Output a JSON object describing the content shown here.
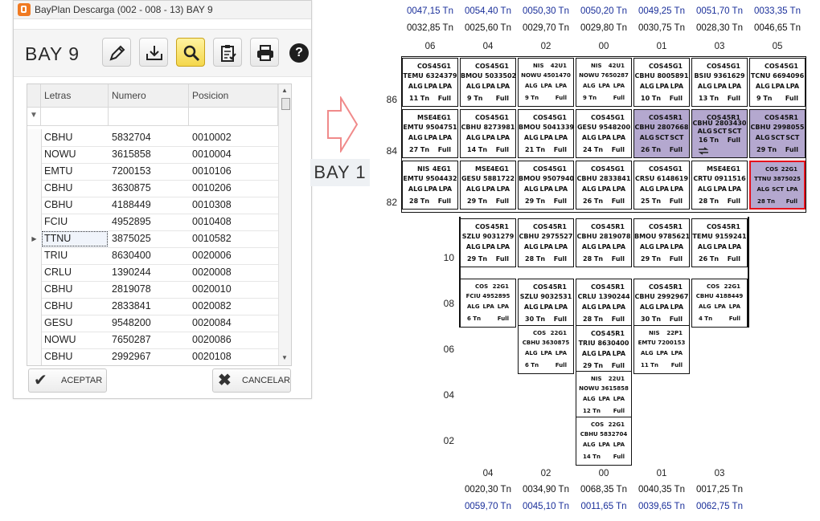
{
  "window": {
    "title": "BayPlan Descarga (002 - 008 - 13) BAY 9",
    "bay_label": "BAY 9",
    "toolbar_icons": [
      "pencil-icon",
      "download-tray-icon",
      "magnifier-icon",
      "clipboard-check-icon",
      "printer-icon",
      "help-icon"
    ],
    "help_label": "?"
  },
  "grid": {
    "columns": [
      "Letras",
      "Numero",
      "Posicion"
    ],
    "rows": [
      {
        "letras": "CBHU",
        "numero": "5832704",
        "posicion": "0010002"
      },
      {
        "letras": "NOWU",
        "numero": "3615858",
        "posicion": "0010004"
      },
      {
        "letras": "EMTU",
        "numero": "7200153",
        "posicion": "0010106"
      },
      {
        "letras": "CBHU",
        "numero": "3630875",
        "posicion": "0010206"
      },
      {
        "letras": "CBHU",
        "numero": "4188449",
        "posicion": "0010308"
      },
      {
        "letras": "FCIU",
        "numero": "4952895",
        "posicion": "0010408"
      },
      {
        "letras": "TTNU",
        "numero": "3875025",
        "posicion": "0010582"
      },
      {
        "letras": "TRIU",
        "numero": "8630400",
        "posicion": "0020006"
      },
      {
        "letras": "CRLU",
        "numero": "1390244",
        "posicion": "0020008"
      },
      {
        "letras": "CBHU",
        "numero": "2819078",
        "posicion": "0020010"
      },
      {
        "letras": "CBHU",
        "numero": "2833841",
        "posicion": "0020082"
      },
      {
        "letras": "GESU",
        "numero": "9548200",
        "posicion": "0020084"
      },
      {
        "letras": "NOWU",
        "numero": "7650287",
        "posicion": "0020086"
      },
      {
        "letras": "CBHU",
        "numero": "2992967",
        "posicion": "0020108"
      }
    ],
    "selected_index": 6
  },
  "footer": {
    "accept_label": "ACEPTAR",
    "cancel_label": "CANCELAR"
  },
  "bay1_label": "BAY 1",
  "top": {
    "columns": [
      "06",
      "04",
      "02",
      "00",
      "01",
      "03",
      "05"
    ],
    "blue_weights": [
      "0047,15 Tn",
      "0054,40 Tn",
      "0050,30 Tn",
      "0050,20 Tn",
      "0049,25 Tn",
      "0051,70 Tn",
      "0033,35 Tn"
    ],
    "black_weights": [
      "0032,85 Tn",
      "0025,60 Tn",
      "0029,70 Tn",
      "0029,80 Tn",
      "0030,75 Tn",
      "0028,30 Tn",
      "0046,65 Tn"
    ],
    "tiers": [
      "86",
      "84",
      "82"
    ],
    "slots": [
      [
        {
          "op": "COS",
          "iso": "45G1",
          "ctr": "TEMU 6324379",
          "ports": [
            "ALG",
            "LPA",
            "LPA"
          ],
          "wt": "11 Tn",
          "st": "Full",
          "shade": false
        },
        {
          "op": "COS",
          "iso": "45G1",
          "ctr": "BMOU 5033502",
          "ports": [
            "ALG",
            "LPA",
            "LPA"
          ],
          "wt": "9 Tn",
          "st": "Full",
          "shade": false
        },
        {
          "op": "NIS",
          "iso": "42U1",
          "ctr": "NOWU 4501470",
          "ports": [
            "ALG",
            "LPA",
            "LPA"
          ],
          "wt": "9 Tn",
          "st": "Full",
          "shade": false,
          "small": true
        },
        {
          "op": "NIS",
          "iso": "42U1",
          "ctr": "NOWU 7650287",
          "ports": [
            "ALG",
            "LPA",
            "LPA"
          ],
          "wt": "9 Tn",
          "st": "Full",
          "shade": false,
          "small": true
        },
        {
          "op": "COS",
          "iso": "45G1",
          "ctr": "CBHU 8005891",
          "ports": [
            "ALG",
            "LPA",
            "LPA"
          ],
          "wt": "10 Tn",
          "st": "Full",
          "shade": false
        },
        {
          "op": "COS",
          "iso": "45G1",
          "ctr": "BSIU 9361629",
          "ports": [
            "ALG",
            "LPA",
            "LPA"
          ],
          "wt": "13 Tn",
          "st": "Full",
          "shade": false
        },
        {
          "op": "COS",
          "iso": "45G1",
          "ctr": "TCNU 6694096",
          "ports": [
            "ALG",
            "LPA",
            "LPA"
          ],
          "wt": "9 Tn",
          "st": "Full",
          "shade": false
        }
      ],
      [
        {
          "op": "MSE",
          "iso": "4EG1",
          "ctr": "EMTU 9504751",
          "ports": [
            "ALG",
            "LPA",
            "LPA"
          ],
          "wt": "27 Tn",
          "st": "Full",
          "shade": false
        },
        {
          "op": "COS",
          "iso": "45G1",
          "ctr": "CBHU 8273981",
          "ports": [
            "ALG",
            "LPA",
            "LPA"
          ],
          "wt": "14 Tn",
          "st": "Full",
          "shade": false
        },
        {
          "op": "COS",
          "iso": "45G1",
          "ctr": "BMOU 5041339",
          "ports": [
            "ALG",
            "LPA",
            "LPA"
          ],
          "wt": "21 Tn",
          "st": "Full",
          "shade": false
        },
        {
          "op": "COS",
          "iso": "45G1",
          "ctr": "GESU 9548200",
          "ports": [
            "ALG",
            "LPA",
            "LPA"
          ],
          "wt": "24 Tn",
          "st": "Full",
          "shade": false
        },
        {
          "op": "COS",
          "iso": "45R1",
          "ctr": "CBHU 2807668",
          "ports": [
            "ALG",
            "SCT",
            "SCT"
          ],
          "wt": "26 Tn",
          "st": "Full",
          "shade": true
        },
        {
          "op": "COS",
          "iso": "45R1",
          "ctr": "CBHU 2803430",
          "ports": [
            "ALG",
            "SCT",
            "SCT"
          ],
          "wt": "16 Tn",
          "st": "Full",
          "shade": true,
          "swap": true
        },
        {
          "op": "COS",
          "iso": "45R1",
          "ctr": "CBHU 2998055",
          "ports": [
            "ALG",
            "SCT",
            "SCT"
          ],
          "wt": "29 Tn",
          "st": "Full",
          "shade": true
        }
      ],
      [
        {
          "op": "NIS",
          "iso": "4EG1",
          "ctr": "EMTU 9504432",
          "ports": [
            "ALG",
            "LPA",
            "LPA"
          ],
          "wt": "28 Tn",
          "st": "Full",
          "shade": false
        },
        {
          "op": "MSE",
          "iso": "4EG1",
          "ctr": "GESU 5881722",
          "ports": [
            "ALG",
            "LPA",
            "LPA"
          ],
          "wt": "29 Tn",
          "st": "Full",
          "shade": false
        },
        {
          "op": "COS",
          "iso": "45G1",
          "ctr": "BMOU 9507940",
          "ports": [
            "ALG",
            "LPA",
            "LPA"
          ],
          "wt": "29 Tn",
          "st": "Full",
          "shade": false
        },
        {
          "op": "COS",
          "iso": "45G1",
          "ctr": "CBHU 2833841",
          "ports": [
            "ALG",
            "LPA",
            "LPA"
          ],
          "wt": "26 Tn",
          "st": "Full",
          "shade": false
        },
        {
          "op": "COS",
          "iso": "45G1",
          "ctr": "CRSU 6148619",
          "ports": [
            "ALG",
            "LPA",
            "LPA"
          ],
          "wt": "25 Tn",
          "st": "Full",
          "shade": false
        },
        {
          "op": "MSE",
          "iso": "4EG1",
          "ctr": "CRTU 0911516",
          "ports": [
            "ALG",
            "LPA",
            "LPA"
          ],
          "wt": "28 Tn",
          "st": "Full",
          "shade": false
        },
        {
          "op": "COS",
          "iso": "22G1",
          "ctr": "TTNU 3875025",
          "ports": [
            "ALG",
            "SCT",
            "LPA"
          ],
          "wt": "28 Tn",
          "st": "Full",
          "shade": true,
          "red": true,
          "small": true
        }
      ]
    ]
  },
  "bottom": {
    "columns": [
      "04",
      "02",
      "00",
      "01",
      "03"
    ],
    "black_weights": [
      "0020,30 Tn",
      "0034,90 Tn",
      "0068,35 Tn",
      "0040,35 Tn",
      "0017,25 Tn"
    ],
    "blue_weights": [
      "0059,70 Tn",
      "0045,10 Tn",
      "0011,65 Tn",
      "0039,65 Tn",
      "0062,75 Tn"
    ],
    "tiers": [
      "10",
      "08",
      "06",
      "04",
      "02"
    ],
    "slots": [
      [
        {
          "op": "COS",
          "iso": "45R1",
          "ctr": "SZLU 9031279",
          "ports": [
            "ALG",
            "LPA",
            "LPA"
          ],
          "wt": "29 Tn",
          "st": "Full"
        },
        {
          "op": "COS",
          "iso": "45R1",
          "ctr": "CBHU 2975527",
          "ports": [
            "ALG",
            "LPA",
            "LPA"
          ],
          "wt": "28 Tn",
          "st": "Full"
        },
        {
          "op": "COS",
          "iso": "45R1",
          "ctr": "CBHU 2819078",
          "ports": [
            "ALG",
            "LPA",
            "LPA"
          ],
          "wt": "28 Tn",
          "st": "Full"
        },
        {
          "op": "COS",
          "iso": "45R1",
          "ctr": "BMOU 9785621",
          "ports": [
            "ALG",
            "LPA",
            "LPA"
          ],
          "wt": "29 Tn",
          "st": "Full"
        },
        {
          "op": "COS",
          "iso": "45R1",
          "ctr": "TEMU 9159241",
          "ports": [
            "ALG",
            "LPA",
            "LPA"
          ],
          "wt": "26 Tn",
          "st": "Full"
        }
      ],
      [
        {
          "op": "COS",
          "iso": "22G1",
          "ctr": "FCIU 4952895",
          "ports": [
            "ALG",
            "LPA",
            "LPA"
          ],
          "wt": "6 Tn",
          "st": "Full",
          "small": true
        },
        {
          "op": "COS",
          "iso": "45R1",
          "ctr": "SZLU 9032531",
          "ports": [
            "ALG",
            "LPA",
            "LPA"
          ],
          "wt": "30 Tn",
          "st": "Full"
        },
        {
          "op": "COS",
          "iso": "45R1",
          "ctr": "CRLU 1390244",
          "ports": [
            "ALG",
            "LPA",
            "LPA"
          ],
          "wt": "28 Tn",
          "st": "Full"
        },
        {
          "op": "COS",
          "iso": "45R1",
          "ctr": "CBHU 2992967",
          "ports": [
            "ALG",
            "LPA",
            "LPA"
          ],
          "wt": "30 Tn",
          "st": "Full"
        },
        {
          "op": "COS",
          "iso": "22G1",
          "ctr": "CBHU 4188449",
          "ports": [
            "ALG",
            "LPA",
            "LPA"
          ],
          "wt": "4 Tn",
          "st": "Full",
          "small": true
        }
      ],
      [
        null,
        {
          "op": "COS",
          "iso": "22G1",
          "ctr": "CBHU 3630875",
          "ports": [
            "ALG",
            "LPA",
            "LPA"
          ],
          "wt": "6 Tn",
          "st": "Full",
          "small": true
        },
        {
          "op": "COS",
          "iso": "45R1",
          "ctr": "TRIU 8630400",
          "ports": [
            "ALG",
            "LPA",
            "LPA"
          ],
          "wt": "29 Tn",
          "st": "Full"
        },
        {
          "op": "NIS",
          "iso": "22P1",
          "ctr": "EMTU 7200153",
          "ports": [
            "ALG",
            "LPA",
            "LPA"
          ],
          "wt": "11 Tn",
          "st": "Full",
          "small": true
        },
        null
      ],
      [
        null,
        null,
        {
          "op": "NIS",
          "iso": "22U1",
          "ctr": "NOWU 3615858",
          "ports": [
            "ALG",
            "LPA",
            "LPA"
          ],
          "wt": "12 Tn",
          "st": "Full",
          "small": true
        },
        null,
        null
      ],
      [
        null,
        null,
        {
          "op": "COS",
          "iso": "22G1",
          "ctr": "CBHU 5832704",
          "ports": [
            "ALG",
            "LPA",
            "LPA"
          ],
          "wt": "14 Tn",
          "st": "Full",
          "small": true
        },
        null,
        null
      ]
    ]
  }
}
